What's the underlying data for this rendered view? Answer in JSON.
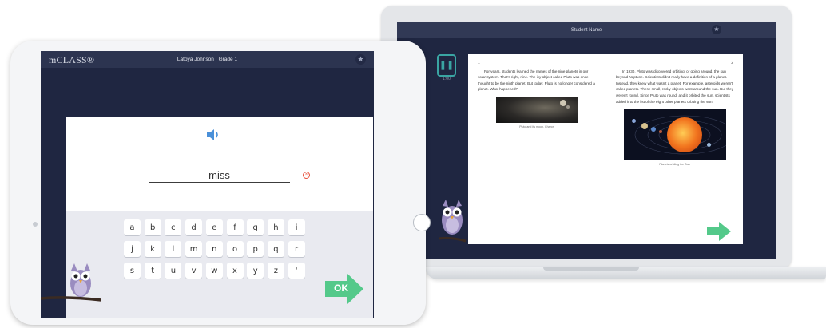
{
  "laptop": {
    "header_title": "Student Name",
    "timer": "1:00",
    "page_left": {
      "number": "1",
      "text": "For years, students learned the names of the nine planets in our solar system. That's right, nine. The icy object called Pluto was once thought to be the ninth planet. But today, Pluto is no longer considered a planet. What happened?",
      "caption": "Pluto and its moon, Charon"
    },
    "page_right": {
      "number": "2",
      "text": "In 1930, Pluto was discovered orbiting, or going around, the sun beyond Neptune. Scientists didn't really have a definition of a planet. Instead, they knew what wasn't a planet. For example, asteroids weren't called planets. These small, rocky objects went around the sun. But they weren't round. Since Pluto was round, and it orbited the sun, scientists added it to the list of the eight other planets orbiting the sun.",
      "caption": "Planets orbiting the Sun"
    }
  },
  "tablet": {
    "logo": "mCLASS®",
    "header_title": "Latoya Johnson · Grade 1",
    "word": "miss",
    "keyboard_rows": [
      [
        "a",
        "b",
        "c",
        "d",
        "e",
        "f",
        "g",
        "h",
        "i"
      ],
      [
        "j",
        "k",
        "l",
        "m",
        "n",
        "o",
        "p",
        "q",
        "r"
      ],
      [
        "s",
        "t",
        "u",
        "v",
        "w",
        "x",
        "y",
        "z",
        "'"
      ]
    ],
    "ok_label": "OK"
  },
  "colors": {
    "screen_bg": "#1f2641",
    "topbar": "#2c3450",
    "accent_green": "#54c98a",
    "accent_teal": "#3aa5a3",
    "speaker_blue": "#4a90d9",
    "clear_red": "#e8533f"
  },
  "icons": {
    "star": "star-icon",
    "pause": "pause-icon",
    "speaker": "speaker-icon",
    "clear": "clear-icon",
    "next": "next-arrow-icon"
  }
}
